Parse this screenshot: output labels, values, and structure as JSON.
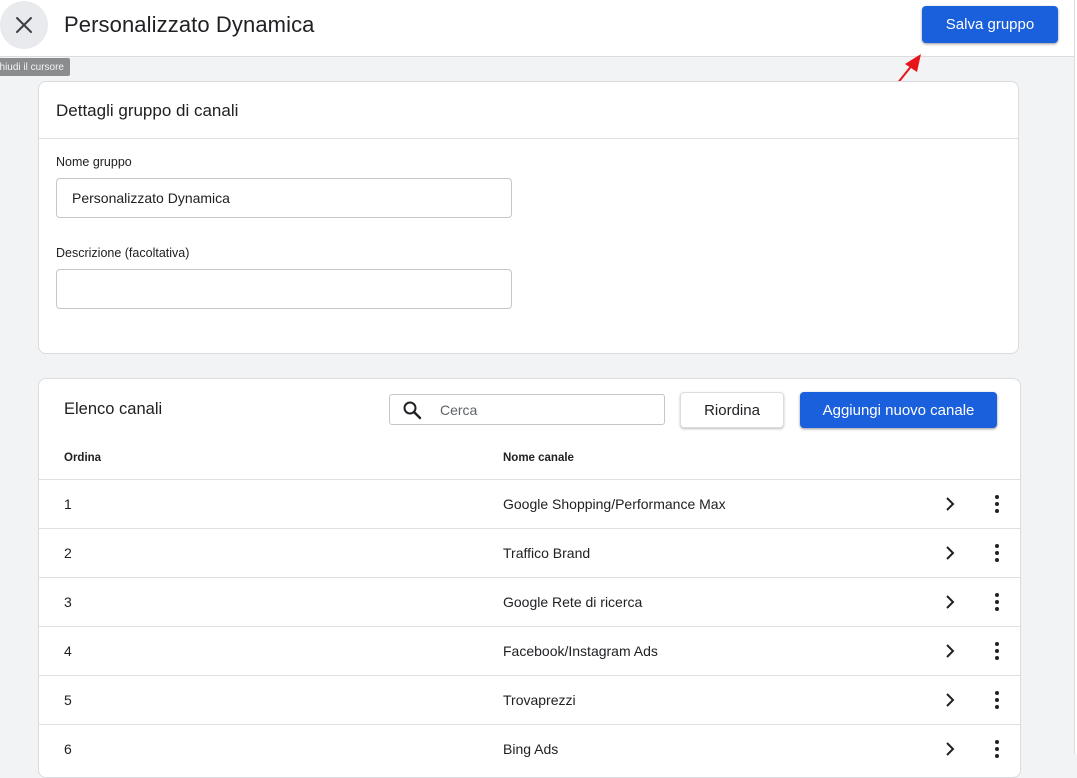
{
  "header": {
    "title": "Personalizzato Dynamica",
    "save_label": "Salva gruppo",
    "close_icon": "close-icon"
  },
  "tooltip": "Chiudi il cursore",
  "details": {
    "title": "Dettagli gruppo di canali",
    "name_label": "Nome gruppo",
    "name_value": "Personalizzato Dynamica",
    "description_label": "Descrizione (facoltativa)",
    "description_value": ""
  },
  "channels": {
    "title": "Elenco canali",
    "search_placeholder": "Cerca",
    "reorder_label": "Riordina",
    "add_label": "Aggiungi nuovo canale",
    "columns": {
      "order": "Ordina",
      "name": "Nome canale"
    },
    "rows": [
      {
        "order": "1",
        "name": "Google Shopping/Performance Max"
      },
      {
        "order": "2",
        "name": "Traffico Brand"
      },
      {
        "order": "3",
        "name": "Google Rete di ricerca"
      },
      {
        "order": "4",
        "name": "Facebook/Instagram Ads"
      },
      {
        "order": "5",
        "name": "Trovaprezzi"
      },
      {
        "order": "6",
        "name": "Bing Ads"
      }
    ]
  },
  "colors": {
    "accent": "#1a5fdc",
    "annotation": "#e8141b",
    "background": "#f1f3f4"
  }
}
